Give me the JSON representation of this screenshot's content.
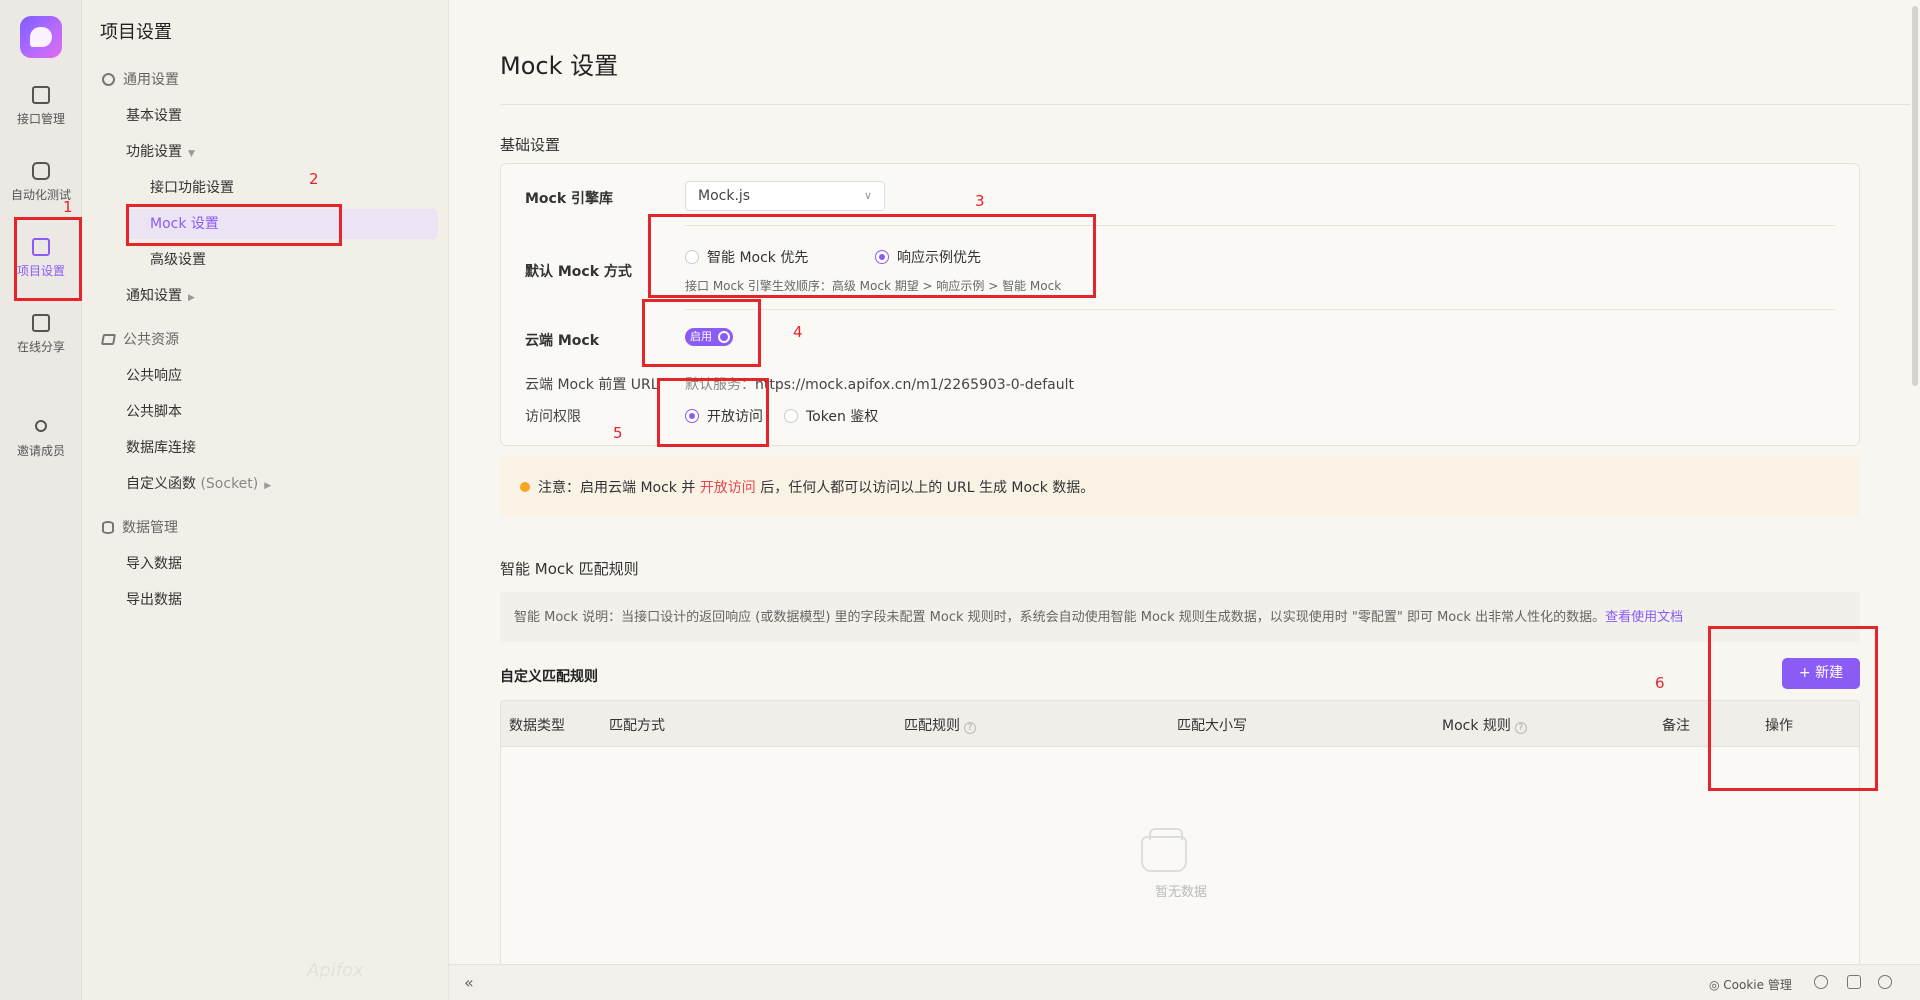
{
  "rail": {
    "items": [
      {
        "label": "接口管理"
      },
      {
        "label": "自动化测试"
      },
      {
        "label": "项目设置"
      },
      {
        "label": "在线分享"
      },
      {
        "label": "邀请成员"
      }
    ],
    "active_color": "#8a5cf5"
  },
  "nav": {
    "title": "项目设置",
    "general_group": "通用设置",
    "basic": "基本设置",
    "feature": "功能设置",
    "api_feature": "接口功能设置",
    "mock": "Mock 设置",
    "advanced": "高级设置",
    "notify": "通知设置",
    "public_group": "公共资源",
    "public_response": "公共响应",
    "public_script": "公共脚本",
    "db_conn": "数据库连接",
    "custom_func": "自定义函数",
    "custom_func_suffix": "(Socket)",
    "data_group": "数据管理",
    "import": "导入数据",
    "export": "导出数据",
    "watermark": "Apifox"
  },
  "main": {
    "title": "Mock 设置",
    "basic_section": "基础设置",
    "engine_label": "Mock 引擎库",
    "engine_value": "Mock.js",
    "default_mode_label": "默认 Mock 方式",
    "mode_options": [
      {
        "label": "智能 Mock 优先",
        "selected": false
      },
      {
        "label": "响应示例优先",
        "selected": true
      }
    ],
    "mode_hint": "接口 Mock 引擎生效顺序：高级 Mock 期望 > 响应示例 > 智能 Mock",
    "cloud_label": "云端 Mock",
    "cloud_toggle": "启用",
    "cloud_enabled": true,
    "url_label": "云端 Mock 前置 URL",
    "url_prefix": "默认服务：",
    "url_value": "https://mock.apifox.cn/m1/2265903-0-default",
    "access_label": "访问权限",
    "access_options": [
      {
        "label": "开放访问",
        "selected": true
      },
      {
        "label": "Token 鉴权",
        "selected": false
      }
    ],
    "notice_pre": "注意：启用云端 Mock 并",
    "notice_hl": "开放访问",
    "notice_post": "后，任何人都可以访问以上的 URL 生成 Mock 数据。",
    "smart_section": "智能 Mock 匹配规则",
    "smart_desc": "智能 Mock 说明：当接口设计的返回响应 (或数据模型) 里的字段未配置 Mock 规则时，系统会自动使用智能 Mock 规则生成数据，以实现使用时 \"零配置\" 即可 Mock 出非常人性化的数据。",
    "smart_link": "查看使用文档",
    "custom_title": "自定义匹配规则",
    "new_button": "+ 新建",
    "columns": [
      "数据类型",
      "匹配方式",
      "匹配规则",
      "匹配大小写",
      "Mock 规则",
      "备注",
      "操作"
    ],
    "empty": "暂无数据"
  },
  "footer": {
    "collapse": "«",
    "cookie": "Cookie 管理"
  },
  "annotations": [
    "1",
    "2",
    "3",
    "4",
    "5",
    "6"
  ],
  "colors": {
    "accent": "#8a5cf5",
    "annotation": "#e4252a",
    "notice_bg": "#fbf2e6"
  }
}
